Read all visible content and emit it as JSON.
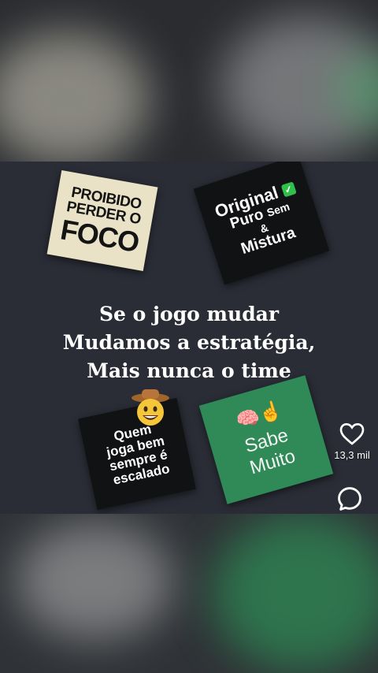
{
  "post": {
    "sticker_foco": {
      "line1": "PROIBIDO",
      "line2": "PERDER O",
      "line3": "FOCO"
    },
    "sticker_original": {
      "line1": "Original",
      "line2": "Puro",
      "line2b": "Sem",
      "line3": "&",
      "line4": "Mistura"
    },
    "headline": {
      "line1": "Se o jogo mudar",
      "line2": "Mudamos a estratégia,",
      "line3": "Mais nunca o time"
    },
    "sticker_quem": {
      "line1": "Quem",
      "line2": "joga bem",
      "line3": "sempre é",
      "line4": "escalado"
    },
    "sticker_sabe": {
      "emoji": "🧠☝",
      "line1": "Sabe",
      "line2": "Muito"
    }
  },
  "actions": {
    "like_icon": "heart-outline-icon",
    "like_count": "13,3 mil",
    "comment_icon": "comment-bubble-icon"
  },
  "colors": {
    "background": "#2a2d36",
    "sticker_green": "#2f8a58",
    "sticker_cream": "#e9e2c6"
  }
}
